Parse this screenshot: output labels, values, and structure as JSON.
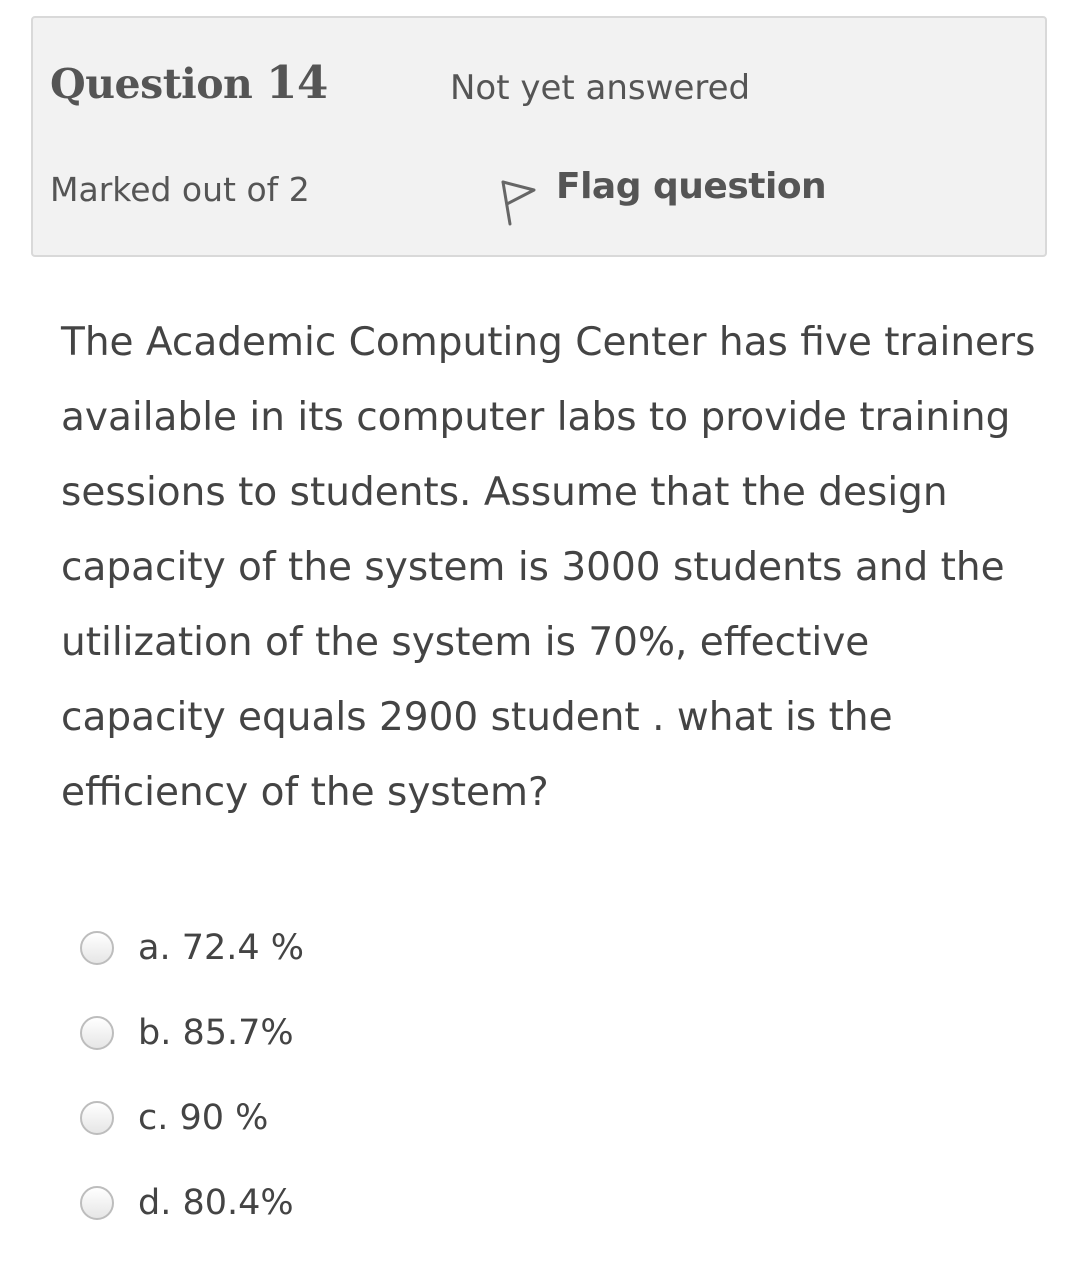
{
  "info": {
    "question_word": "Question",
    "question_number": "14",
    "state": "Not yet answered",
    "grade": "Marked out of 2",
    "flag_label": "Flag question",
    "flag_icon": "flag-outline-icon"
  },
  "question": {
    "lines": [
      "The Academic Computing Center has five trainers",
      "available in its computer labs to provide training",
      "sessions to students. Assume that the design",
      "capacity of the system is 3000 students and the",
      "utilization of the system is 70%, effective",
      "capacity equals 2900 student . what is the",
      "efficiency of the system?"
    ]
  },
  "answers": [
    {
      "label": "a. 72.4 %",
      "selected": false
    },
    {
      "label": "b. 85.7%",
      "selected": false
    },
    {
      "label": "c. 90 %",
      "selected": false
    },
    {
      "label": "d. 80.4%",
      "selected": false
    }
  ]
}
